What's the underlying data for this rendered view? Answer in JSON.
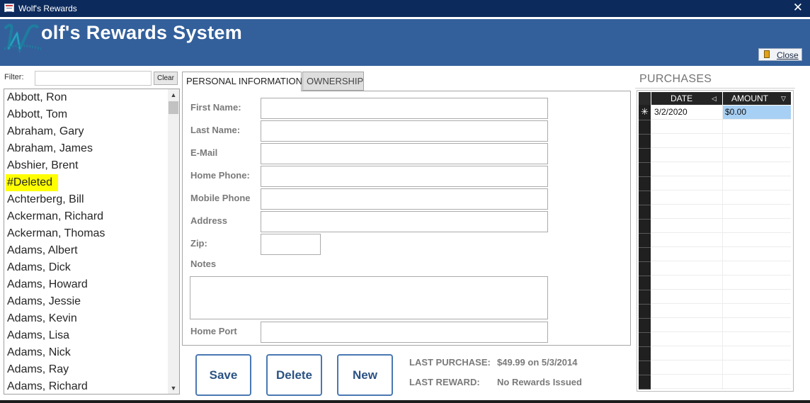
{
  "window": {
    "title": "Wolf's Rewards",
    "close_glyph": "✕"
  },
  "header": {
    "app_title": "olf's Rewards System",
    "close_label": "Close"
  },
  "filter": {
    "label": "Filter:",
    "value": "",
    "clear_label": "Clear"
  },
  "customers": [
    "Abbott, Ron",
    "Abbott, Tom",
    "Abraham, Gary",
    "Abraham, James",
    "Abshier, Brent",
    "#Deleted",
    "Achterberg, Bill",
    "Ackerman, Richard",
    "Ackerman, Thomas",
    "Adams, Albert",
    "Adams, Dick",
    "Adams, Howard",
    "Adams, Jessie",
    "Adams, Kevin",
    "Adams, Lisa",
    "Adams, Nick",
    "Adams, Ray",
    "Adams, Richard"
  ],
  "tabs": {
    "personal": "PERSONAL INFORMATION",
    "ownership": "OWNERSHIP"
  },
  "form": {
    "first_name": {
      "label": "First Name:",
      "value": ""
    },
    "last_name": {
      "label": "Last Name:",
      "value": ""
    },
    "email": {
      "label": "E-Mail",
      "value": ""
    },
    "home_phone": {
      "label": "Home Phone:",
      "value": ""
    },
    "mobile_phone": {
      "label": "Mobile Phone",
      "value": ""
    },
    "address": {
      "label": "Address",
      "value": ""
    },
    "zip": {
      "label": "Zip:",
      "value": ""
    },
    "notes": {
      "label": "Notes",
      "value": ""
    },
    "home_port": {
      "label": "Home Port",
      "value": ""
    }
  },
  "actions": {
    "save": "Save",
    "delete": "Delete",
    "new": "New"
  },
  "summary": {
    "last_purchase_label": "LAST PURCHASE:",
    "last_purchase_value": "$49.99 on 5/3/2014",
    "last_reward_label": "LAST REWARD:",
    "last_reward_value": "No Rewards Issued"
  },
  "purchases": {
    "title": "PURCHASES",
    "columns": {
      "date": "DATE",
      "amount": "AMOUNT"
    },
    "new_row_marker": "✳",
    "new_row": {
      "date": "3/2/2020",
      "amount": "$0.00"
    }
  },
  "colors": {
    "titlebar": "#0c2a5c",
    "header": "#33609b",
    "button_border": "#4978b2",
    "highlight": "#ffff00",
    "selected_cell": "#a8d0f4"
  }
}
